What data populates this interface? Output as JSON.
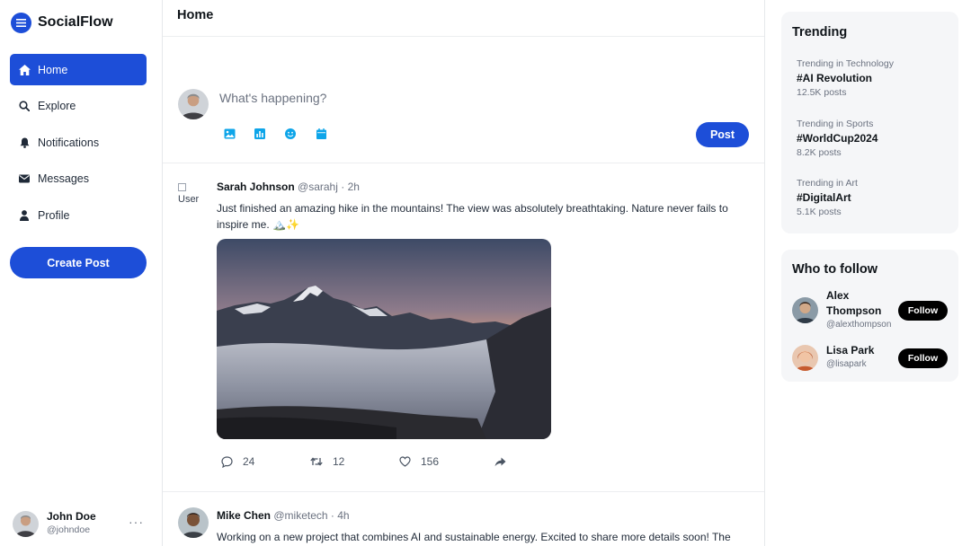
{
  "brand": {
    "name": "SocialFlow",
    "logo_icon": "menu-lines-icon",
    "accent": "#1d4ed8"
  },
  "sidebar": {
    "items": [
      {
        "label": "Home",
        "icon": "home-icon",
        "active": true
      },
      {
        "label": "Explore",
        "icon": "search-icon",
        "active": false
      },
      {
        "label": "Notifications",
        "icon": "bell-icon",
        "active": false
      },
      {
        "label": "Messages",
        "icon": "envelope-icon",
        "active": false
      },
      {
        "label": "Profile",
        "icon": "user-icon",
        "active": false
      }
    ],
    "create_label": "Create Post"
  },
  "current_user": {
    "name": "John Doe",
    "handle": "@johndoe",
    "more": "···"
  },
  "main": {
    "title": "Home",
    "composer": {
      "placeholder": "What's happening?",
      "tools": [
        "image-icon",
        "chart-icon",
        "emoji-icon",
        "calendar-icon"
      ],
      "post_label": "Post"
    },
    "posts": [
      {
        "avatar_alt": "User",
        "author": "Sarah Johnson",
        "handle": "@sarahj",
        "dot": "·",
        "time": "2h",
        "text": "Just finished an amazing hike in the mountains! The view was absolutely breathtaking. Nature never fails to inspire me. 🏔️✨",
        "image": "mountain-sunset-photo",
        "replies": "24",
        "reposts": "12",
        "likes": "156"
      },
      {
        "author": "Mike Chen",
        "handle": "@miketech",
        "dot": "·",
        "time": "4h",
        "text": "Working on a new project that combines AI and sustainable energy. Excited to share more details soon! The"
      }
    ]
  },
  "trending": {
    "title": "Trending",
    "items": [
      {
        "category": "Trending in Technology",
        "tag": "#AI Revolution",
        "count": "12.5K posts"
      },
      {
        "category": "Trending in Sports",
        "tag": "#WorldCup2024",
        "count": "8.2K posts"
      },
      {
        "category": "Trending in Art",
        "tag": "#DigitalArt",
        "count": "5.1K posts"
      }
    ]
  },
  "who_to_follow": {
    "title": "Who to follow",
    "users": [
      {
        "name": "Alex Thompson",
        "handle": "@alexthompson",
        "button": "Follow"
      },
      {
        "name": "Lisa Park",
        "handle": "@lisapark",
        "button": "Follow"
      }
    ]
  }
}
